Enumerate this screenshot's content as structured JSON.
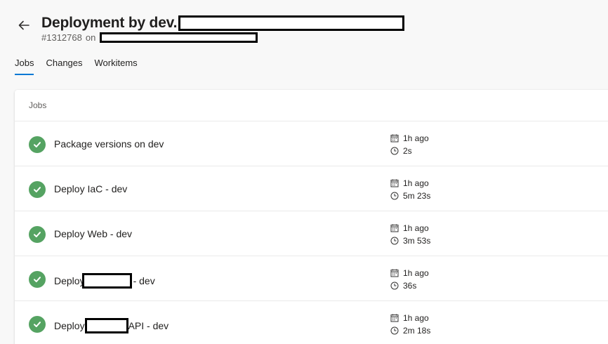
{
  "header": {
    "title": "Deployment by dev.",
    "run_number": "#1312768",
    "on_label": "on"
  },
  "tabs": [
    {
      "label": "Jobs",
      "active": true
    },
    {
      "label": "Changes",
      "active": false
    },
    {
      "label": "Workitems",
      "active": false
    }
  ],
  "jobs_card": {
    "header": "Jobs",
    "jobs": [
      {
        "name_prefix": "Package versions on dev",
        "name_suffix": "",
        "started": "1h ago",
        "duration": "2s",
        "status": "succeeded"
      },
      {
        "name_prefix": "Deploy IaC - dev",
        "name_suffix": "",
        "started": "1h ago",
        "duration": "5m 23s",
        "status": "succeeded"
      },
      {
        "name_prefix": "Deploy Web - dev",
        "name_suffix": "",
        "started": "1h ago",
        "duration": "3m 53s",
        "status": "succeeded"
      },
      {
        "name_prefix": "Deploy",
        "name_suffix": "- dev",
        "started": "1h ago",
        "duration": "36s",
        "status": "succeeded"
      },
      {
        "name_prefix": "Deploy",
        "name_suffix": "API - dev",
        "started": "1h ago",
        "duration": "2m 18s",
        "status": "succeeded"
      }
    ]
  },
  "colors": {
    "accent": "#0078d4",
    "success": "#55a362"
  },
  "icons": {
    "back": "arrow-left-icon",
    "status": "check-circle-icon",
    "calendar": "calendar-icon",
    "clock": "clock-icon"
  }
}
